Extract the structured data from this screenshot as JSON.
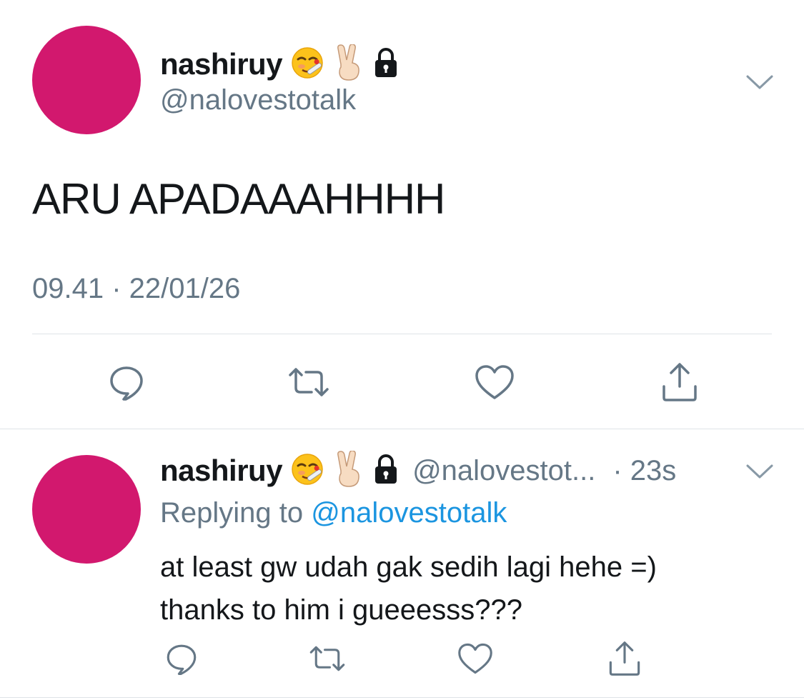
{
  "colors": {
    "avatar": "#d2186e",
    "muted": "#657786",
    "link": "#1b95e0",
    "divider": "#dfe3e7"
  },
  "main_tweet": {
    "display_name": "nashiruy",
    "name_icons": [
      "face-with-thermometer-emoji",
      "victory-hand-emoji",
      "lock-icon"
    ],
    "handle": "@nalovestotalk",
    "text": "ARU APADAAAHHHH",
    "timestamp": "09.41 · 22/01/26",
    "actions": [
      "reply-icon",
      "retweet-icon",
      "like-icon",
      "share-icon"
    ]
  },
  "reply_tweet": {
    "display_name": "nashiruy",
    "name_icons": [
      "face-with-thermometer-emoji",
      "victory-hand-emoji",
      "lock-icon"
    ],
    "handle": "@nalovestot...",
    "time": "· 23s",
    "replying_prefix": "Replying to",
    "replying_handle": "@nalovestotalk",
    "text_line1": "at least gw udah gak sedih lagi hehe =)",
    "text_line2": "thanks to him i gueeesss???",
    "actions": [
      "reply-icon",
      "retweet-icon",
      "like-icon",
      "share-icon"
    ]
  }
}
